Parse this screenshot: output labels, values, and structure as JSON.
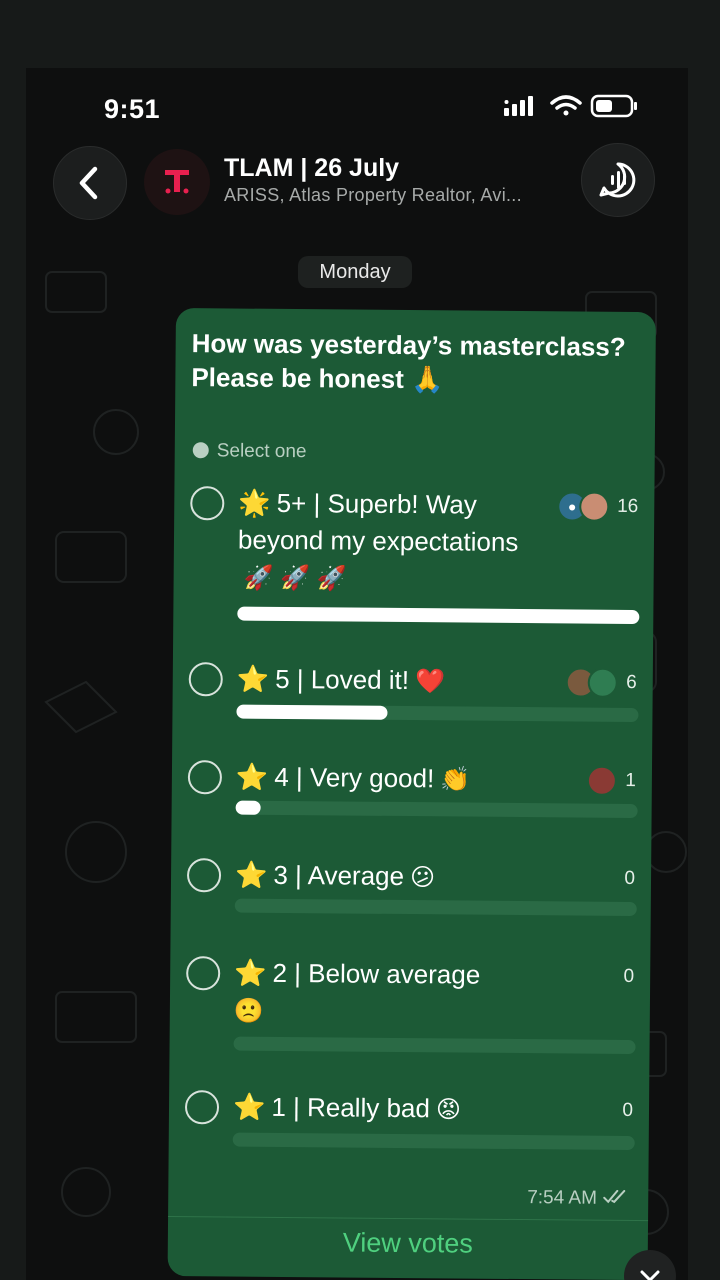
{
  "status_bar": {
    "time": "9:51"
  },
  "header": {
    "title": "TLAM | 26 July",
    "subtitle": "ARISS, Atlas Property Realtor, Avi...",
    "avatar_letter": "T"
  },
  "day_badge": "Monday",
  "poll": {
    "question": "How was yesterday’s masterclass? Please be honest 🙏",
    "hint": "Select one",
    "options": [
      {
        "star": "🌟",
        "label": "5+ | Superb! Way beyond my expectations",
        "emoji": "🚀 🚀 🚀",
        "count": "16",
        "fraction": 1.0
      },
      {
        "star": "⭐",
        "label": "5 | Loved it!",
        "emoji": "❤️",
        "count": "6",
        "fraction": 0.375
      },
      {
        "star": "⭐",
        "label": "4 | Very good!",
        "emoji": "👏",
        "count": "1",
        "fraction": 0.0625
      },
      {
        "star": "⭐",
        "label": "3 | Average",
        "emoji": "😕",
        "count": "0",
        "fraction": 0
      },
      {
        "star": "⭐",
        "label": "2 | Below average",
        "emoji": "🙁",
        "count": "0",
        "fraction": 0
      },
      {
        "star": "⭐",
        "label": "1 | Really bad",
        "emoji": "😡",
        "count": "0",
        "fraction": 0
      }
    ],
    "timestamp": "7:54 AM",
    "view_votes": "View votes"
  },
  "colors": {
    "bubble": "#1c5a36",
    "accent_green": "#4fd07f",
    "avatar_red": "#e8204f"
  },
  "icons": [
    "back-chevron-icon",
    "voice-chat-icon",
    "signal-icon",
    "wifi-icon",
    "battery-icon",
    "check-circle-icon",
    "double-check-icon",
    "chevron-down-icon"
  ]
}
